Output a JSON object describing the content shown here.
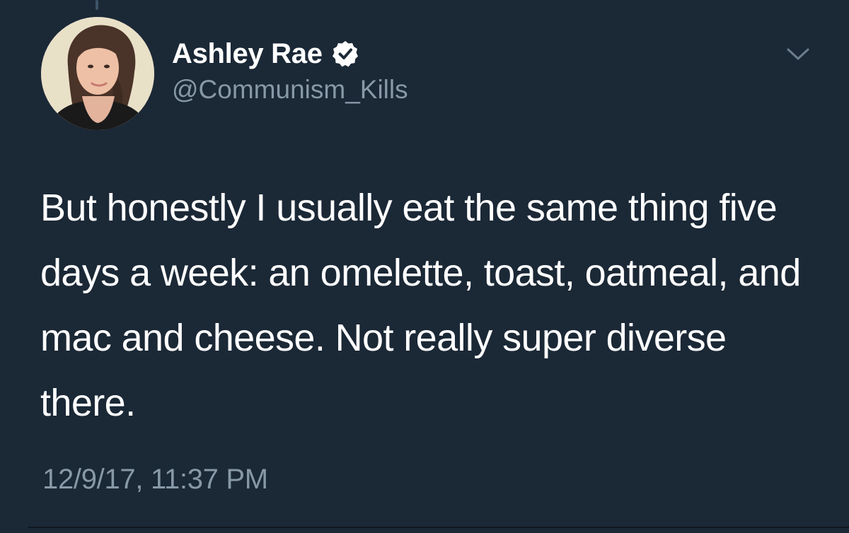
{
  "tweet": {
    "author": {
      "display_name": "Ashley Rae",
      "handle": "@Communism_Kills",
      "verified": true
    },
    "text": "But honestly I usually eat the same thing five days a week: an omelette, toast, oatmeal, and mac and cheese. Not really super diverse there.",
    "timestamp": "12/9/17, 11:37 PM"
  },
  "icons": {
    "verified": "verified-badge-icon",
    "menu": "chevron-down-icon"
  },
  "colors": {
    "background": "#1b2836",
    "primary_text": "#ffffff",
    "secondary_text": "#8899a6"
  }
}
